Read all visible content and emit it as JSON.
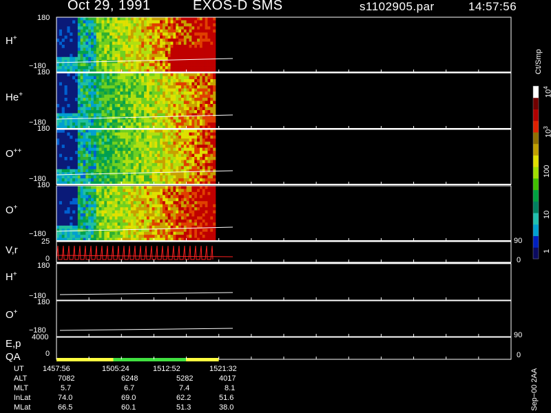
{
  "header": {
    "date": "Oct 29, 1991",
    "instrument": "EXOS-D SMS",
    "file": "s1102905.par",
    "time": "14:57:56"
  },
  "panels": [
    {
      "label": "H",
      "sup": "+",
      "ytop": "180",
      "ybot": "−180"
    },
    {
      "label": "He",
      "sup": "+",
      "ytop": "180",
      "ybot": "−180"
    },
    {
      "label": "O",
      "sup": "++",
      "ytop": "180",
      "ybot": "−180"
    },
    {
      "label": "O",
      "sup": "+",
      "ytop": "180",
      "ybot": "−180"
    },
    {
      "label": "V,r",
      "sup": "",
      "ytop": "25",
      "ybot": "0",
      "rtop": "90",
      "rbot": "0"
    },
    {
      "label": "H",
      "sup": "+",
      "ytop": "180",
      "ybot": "−180"
    },
    {
      "label": "O",
      "sup": "+",
      "ytop": "180",
      "ybot": "−180"
    },
    {
      "label": "E,p",
      "sup": "",
      "ytop": "4000",
      "ybot": "0",
      "rtop": "90",
      "rbot": "0",
      "extra": "QA"
    }
  ],
  "colorbar": {
    "unit": "Ct/Smp",
    "ticks": [
      "1",
      "10",
      "100",
      "10",
      "10"
    ],
    "tick_sups": [
      "",
      "",
      "",
      "3",
      "4"
    ],
    "colors": [
      "#0a0a60",
      "#0020c0",
      "#00a0d0",
      "#20c0b0",
      "#008060",
      "#00a040",
      "#40c000",
      "#a0e000",
      "#e0e000",
      "#c0a000",
      "#907000",
      "#e02000",
      "#b00000",
      "#700000",
      "#ffffff"
    ]
  },
  "footer": {
    "row_labels": [
      "UT",
      "ALT",
      "MLT",
      "InLat",
      "MLat"
    ],
    "columns": [
      [
        "1457:56",
        "7082",
        "5.7",
        "74.0",
        "66.5"
      ],
      [
        "1505:24",
        "6248",
        "6.7",
        "69.0",
        "60.1"
      ],
      [
        "1512:52",
        "5282",
        "7.4",
        "62.2",
        "51.3"
      ],
      [
        "1521:32",
        "4017",
        "8.1",
        "51.6",
        "38.0"
      ]
    ],
    "side_note": "Sep−00  2AA"
  },
  "chart_data": {
    "type": "heatmap",
    "title": "Oct 29, 1991   EXOS-D SMS",
    "xlabel": "UT",
    "x_ticks": [
      "1457:56",
      "1505:24",
      "1512:52",
      "1521:32"
    ],
    "panels": [
      "H+",
      "He+",
      "O++",
      "O+",
      "V,r",
      "H+",
      "O+",
      "E,p"
    ],
    "pitch_angle_range": [
      -180,
      180
    ],
    "color_scale": "log",
    "color_range": [
      1,
      10000
    ],
    "data_end_fraction": 0.35,
    "qa_segments": [
      {
        "color": "#ffff40",
        "from": 0.0,
        "to": 0.125
      },
      {
        "color": "#40e040",
        "from": 0.125,
        "to": 0.285
      },
      {
        "color": "#ffff40",
        "from": 0.285,
        "to": 0.357
      }
    ]
  }
}
